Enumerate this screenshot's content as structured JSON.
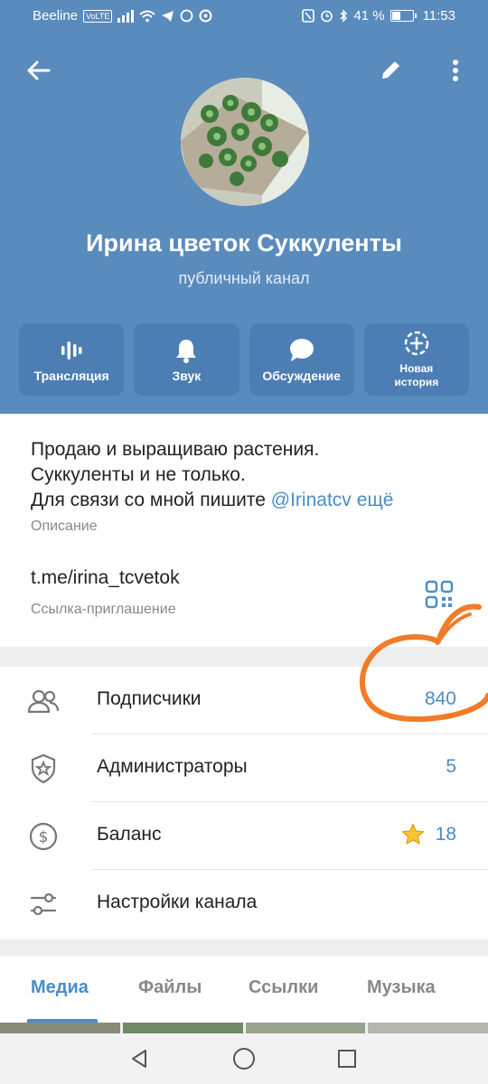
{
  "status_bar": {
    "carrier": "Beeline",
    "volte": "VoLTE",
    "battery": "41 %",
    "time": "11:53"
  },
  "header": {
    "channel_name": "Ирина цветок Суккуленты",
    "channel_type": "публичный канал",
    "icons": {
      "back": "arrow-left-icon",
      "edit": "pencil-icon",
      "more": "more-vertical-icon"
    }
  },
  "actions": [
    {
      "label": "Трансляция",
      "icon": "live-stream-icon"
    },
    {
      "label": "Звук",
      "icon": "bell-icon"
    },
    {
      "label": "Обсуждение",
      "icon": "chat-bubble-icon"
    },
    {
      "label_line1": "Новая",
      "label_line2": "история",
      "icon": "add-story-icon"
    }
  ],
  "description": {
    "line1": "Продаю и выращиваю растения.",
    "line2": "Суккуленты и не только.",
    "line3_prefix": "Для связи со мной пишите ",
    "line3_mention": "@Irinatcv",
    "more": "ещё",
    "caption": "Описание"
  },
  "invite": {
    "link": "t.me/irina_tcvetok",
    "caption": "Ссылка-приглашение"
  },
  "rows": [
    {
      "label": "Подписчики",
      "value": "840",
      "icon": "users-icon"
    },
    {
      "label": "Администраторы",
      "value": "5",
      "icon": "shield-star-icon"
    },
    {
      "label": "Баланс",
      "value": "18",
      "icon": "dollar-circle-icon"
    },
    {
      "label": "Настройки канала",
      "value": "",
      "icon": "sliders-icon"
    }
  ],
  "tabs": [
    "Медиа",
    "Файлы",
    "Ссылки",
    "Музыка"
  ],
  "active_tab": "Медиа",
  "colors": {
    "header": "#5a8bbd",
    "accent": "#4a8dc8",
    "annotation": "#f07c28"
  }
}
